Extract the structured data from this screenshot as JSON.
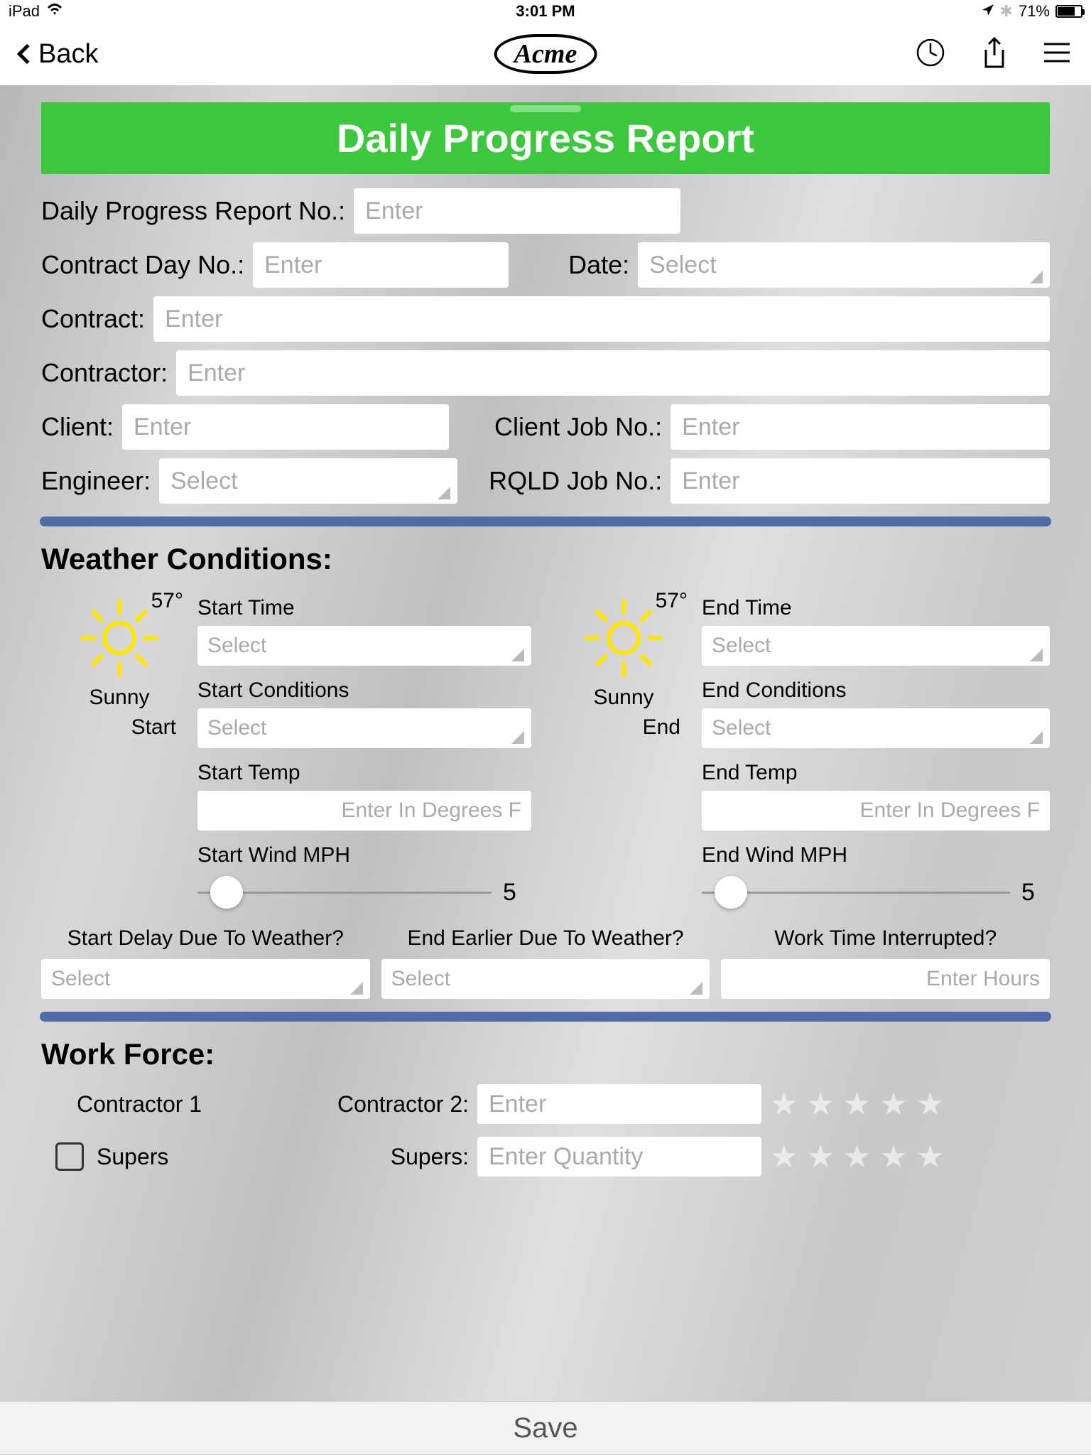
{
  "status": {
    "device": "iPad",
    "time": "3:01 PM",
    "battery": "71%"
  },
  "nav": {
    "back": "Back",
    "logo": "Acme"
  },
  "banner": "Daily Progress Report",
  "fields": {
    "reportNo": {
      "label": "Daily Progress Report No.:",
      "ph": "Enter"
    },
    "contractDay": {
      "label": "Contract Day No.:",
      "ph": "Enter"
    },
    "date": {
      "label": "Date:",
      "ph": "Select"
    },
    "contract": {
      "label": "Contract:",
      "ph": "Enter"
    },
    "contractor": {
      "label": "Contractor:",
      "ph": "Enter"
    },
    "client": {
      "label": "Client:",
      "ph": "Enter"
    },
    "clientJob": {
      "label": "Client Job No.:",
      "ph": "Enter"
    },
    "engineer": {
      "label": "Engineer:",
      "ph": "Select"
    },
    "rqldJob": {
      "label": "RQLD Job No.:",
      "ph": "Enter"
    }
  },
  "weather": {
    "title": "Weather Conditions:",
    "start": {
      "temp": "57°",
      "cond": "Sunny",
      "period": "Start",
      "timeLbl": "Start Time",
      "timePh": "Select",
      "condLbl": "Start Conditions",
      "condPh": "Select",
      "tempLbl": "Start Temp",
      "tempPh": "Enter In Degrees F",
      "windLbl": "Start Wind MPH",
      "windVal": "5"
    },
    "end": {
      "temp": "57°",
      "cond": "Sunny",
      "period": "End",
      "timeLbl": "End Time",
      "timePh": "Select",
      "condLbl": "End Conditions",
      "condPh": "Select",
      "tempLbl": "End Temp",
      "tempPh": "Enter In Degrees F",
      "windLbl": "End Wind MPH",
      "windVal": "5"
    },
    "q": {
      "delayLbl": "Start Delay Due To Weather?",
      "delayPh": "Select",
      "earlyLbl": "End Earlier Due To Weather?",
      "earlyPh": "Select",
      "intLbl": "Work Time Interrupted?",
      "intPh": "Enter Hours"
    }
  },
  "workforce": {
    "title": "Work Force:",
    "c1": "Contractor 1",
    "c2Lbl": "Contractor 2:",
    "c2Ph": "Enter",
    "supers1": "Supers",
    "supers2Lbl": "Supers:",
    "supers2Ph": "Enter Quantity"
  },
  "save": "Save"
}
